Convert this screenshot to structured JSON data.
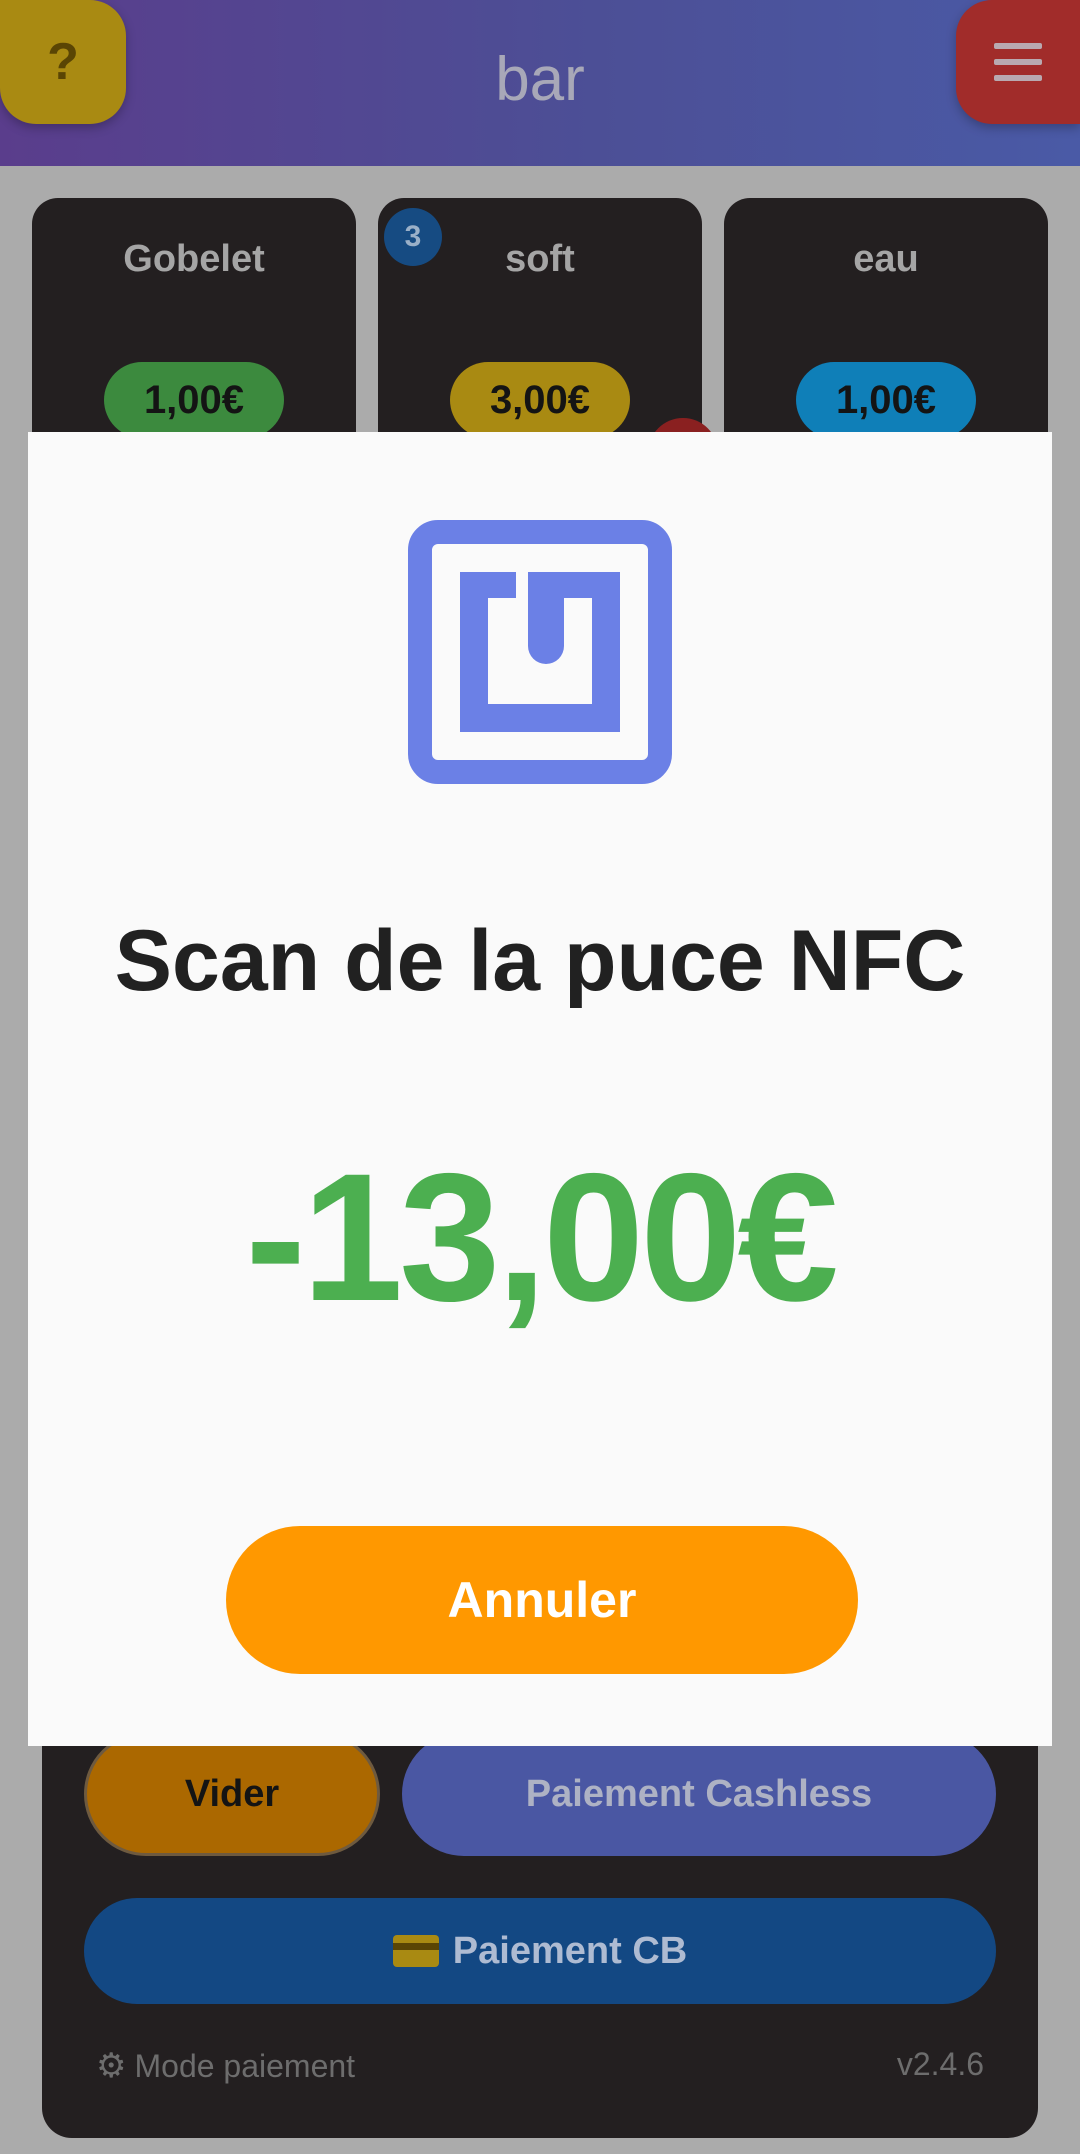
{
  "header": {
    "help_label": "?",
    "title": "bar",
    "menu_icon": "hamburger-menu-icon"
  },
  "products": [
    {
      "name": "Gobelet",
      "price": "1,00€",
      "price_color": "#3c8a3e"
    },
    {
      "name": "soft",
      "price": "3,00€",
      "price_color": "#a98a12",
      "count": "3"
    },
    {
      "name": "eau",
      "price": "1,00€",
      "price_color": "#0f7fb8"
    }
  ],
  "modal": {
    "icon": "nfc-icon",
    "title": "Scan de la puce NFC",
    "amount": "-13,00€",
    "cancel_label": "Annuler"
  },
  "actions": {
    "empty_label": "Vider",
    "cashless_label": "Paiement Cashless",
    "card_label": "Paiement CB",
    "card_icon": "credit-card-icon"
  },
  "footer": {
    "mode_label": "Mode paiement",
    "mode_icon": "gear-icon",
    "version": "v2.4.6"
  },
  "colors": {
    "accent_green": "#4caf50",
    "cancel_orange": "#ff9800",
    "nfc_blue": "#6b80e6"
  }
}
